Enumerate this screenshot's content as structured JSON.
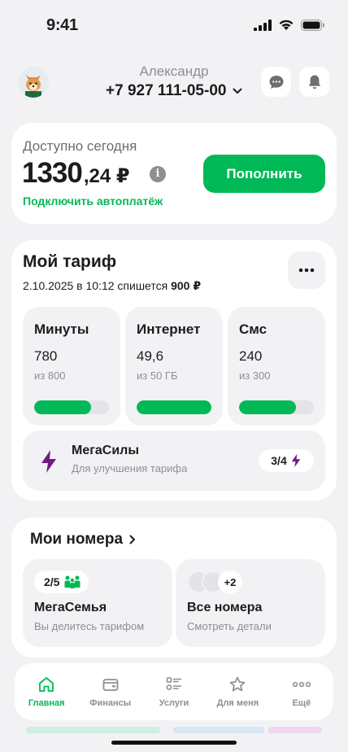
{
  "status_bar": {
    "time": "9:41"
  },
  "header": {
    "user_name": "Александр",
    "phone": "+7 927 111-05-00",
    "chat_icon": "chat-bubble-icon",
    "bell_icon": "bell-icon"
  },
  "balance": {
    "label": "Доступно сегодня",
    "amount_int": "1330",
    "amount_frac": ",24 ₽",
    "autopay_link": "Подключить автоплатёж",
    "topup_label": "Пополнить"
  },
  "tariff": {
    "title": "Мой тариф",
    "charge_date": "2.10.2025 в 10:12 спишется",
    "charge_amount": "900 ₽",
    "quotas": [
      {
        "label": "Минуты",
        "value": "780",
        "total": "из 800",
        "fill": 0.76
      },
      {
        "label": "Интернет",
        "value": "49,6",
        "total": "из 50 ГБ",
        "fill": 1.0
      },
      {
        "label": "Смс",
        "value": "240",
        "total": "из 300",
        "fill": 0.76
      }
    ],
    "megasily": {
      "title": "МегаСилы",
      "subtitle": "Для улучшения тарифа",
      "badge": "3/4"
    }
  },
  "numbers": {
    "title": "Мои номера",
    "family": {
      "badge": "2/5",
      "title": "МегаСемья",
      "subtitle": "Вы делитесь тарифом"
    },
    "all": {
      "count": "+2",
      "title": "Все номера",
      "subtitle": "Смотреть детали"
    }
  },
  "tabbar": {
    "tabs": [
      {
        "label": "Главная",
        "icon": "home-icon",
        "active": true
      },
      {
        "label": "Финансы",
        "icon": "wallet-icon",
        "active": false
      },
      {
        "label": "Услуги",
        "icon": "services-list-icon",
        "active": false
      },
      {
        "label": "Для меня",
        "icon": "star-icon",
        "active": false
      },
      {
        "label": "Ещё",
        "icon": "more-dots-icon",
        "active": false
      }
    ]
  },
  "colors": {
    "accent": "#00b956",
    "purple": "#731982",
    "background": "#f2f2f5"
  }
}
